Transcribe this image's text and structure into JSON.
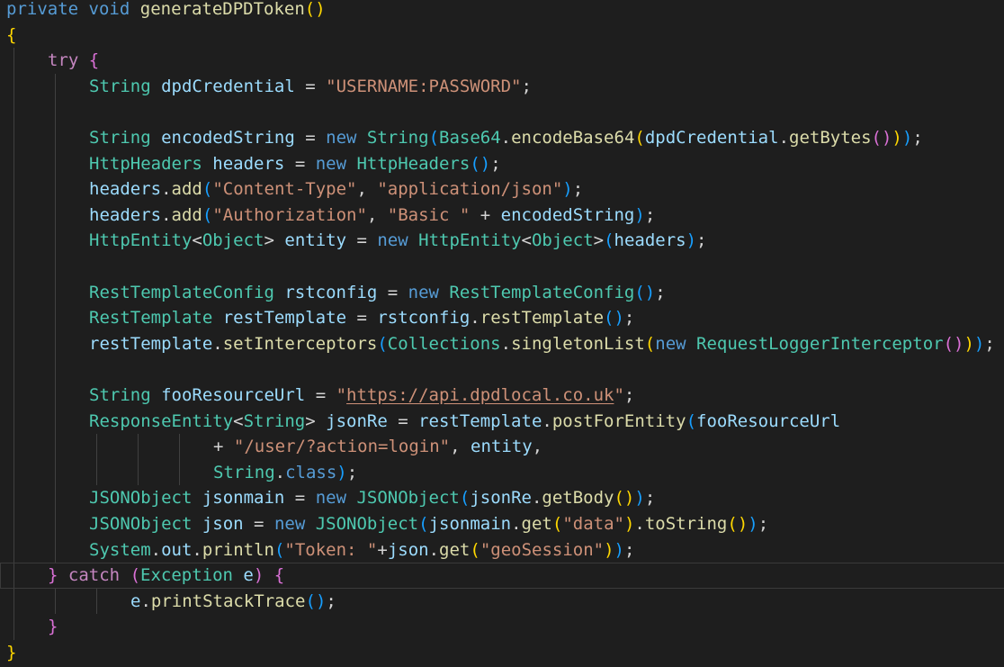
{
  "editor": {
    "language": "java",
    "colors": {
      "background": "#1e1e1e",
      "keyword": "#569cd6",
      "control": "#c586c0",
      "type": "#4ec9b0",
      "function": "#dcdcaa",
      "variable": "#9cdcfe",
      "string": "#ce9178",
      "punctuation": "#d4d4d4",
      "bracket_level_1": "#ffd700",
      "bracket_level_2": "#da70d6",
      "bracket_level_3": "#179fff"
    },
    "lines": [
      {
        "indent": 0,
        "tokens": [
          [
            "private",
            "kw"
          ],
          [
            " ",
            "punct"
          ],
          [
            "void",
            "kw"
          ],
          [
            " ",
            "punct"
          ],
          [
            "generateDPDToken",
            "fn"
          ],
          [
            "()",
            "b1"
          ]
        ]
      },
      {
        "indent": 0,
        "tokens": [
          [
            "{",
            "b1"
          ]
        ]
      },
      {
        "indent": 1,
        "tokens": [
          [
            "try",
            "ctl"
          ],
          [
            " ",
            "punct"
          ],
          [
            "{",
            "b2"
          ]
        ]
      },
      {
        "indent": 2,
        "tokens": [
          [
            "String",
            "type"
          ],
          [
            " ",
            "punct"
          ],
          [
            "dpdCredential",
            "var"
          ],
          [
            " = ",
            "punct"
          ],
          [
            "\"USERNAME:PASSWORD\"",
            "str"
          ],
          [
            ";",
            "punct"
          ]
        ]
      },
      {
        "indent": 2,
        "tokens": []
      },
      {
        "indent": 2,
        "tokens": [
          [
            "String",
            "type"
          ],
          [
            " ",
            "punct"
          ],
          [
            "encodedString",
            "var"
          ],
          [
            " = ",
            "punct"
          ],
          [
            "new",
            "kw"
          ],
          [
            " ",
            "punct"
          ],
          [
            "String",
            "type"
          ],
          [
            "(",
            "b3"
          ],
          [
            "Base64",
            "type"
          ],
          [
            ".",
            "punct"
          ],
          [
            "encodeBase64",
            "fn"
          ],
          [
            "(",
            "b1"
          ],
          [
            "dpdCredential",
            "var"
          ],
          [
            ".",
            "punct"
          ],
          [
            "getBytes",
            "fn"
          ],
          [
            "()",
            "b2"
          ],
          [
            ")",
            "b1"
          ],
          [
            ")",
            "b3"
          ],
          [
            ";",
            "punct"
          ]
        ]
      },
      {
        "indent": 2,
        "tokens": [
          [
            "HttpHeaders",
            "type"
          ],
          [
            " ",
            "punct"
          ],
          [
            "headers",
            "var"
          ],
          [
            " = ",
            "punct"
          ],
          [
            "new",
            "kw"
          ],
          [
            " ",
            "punct"
          ],
          [
            "HttpHeaders",
            "type"
          ],
          [
            "()",
            "b3"
          ],
          [
            ";",
            "punct"
          ]
        ]
      },
      {
        "indent": 2,
        "tokens": [
          [
            "headers",
            "var"
          ],
          [
            ".",
            "punct"
          ],
          [
            "add",
            "fn"
          ],
          [
            "(",
            "b3"
          ],
          [
            "\"Content-Type\"",
            "str"
          ],
          [
            ", ",
            "punct"
          ],
          [
            "\"application/json\"",
            "str"
          ],
          [
            ")",
            "b3"
          ],
          [
            ";",
            "punct"
          ]
        ]
      },
      {
        "indent": 2,
        "tokens": [
          [
            "headers",
            "var"
          ],
          [
            ".",
            "punct"
          ],
          [
            "add",
            "fn"
          ],
          [
            "(",
            "b3"
          ],
          [
            "\"Authorization\"",
            "str"
          ],
          [
            ", ",
            "punct"
          ],
          [
            "\"Basic \"",
            "str"
          ],
          [
            " + ",
            "punct"
          ],
          [
            "encodedString",
            "var"
          ],
          [
            ")",
            "b3"
          ],
          [
            ";",
            "punct"
          ]
        ]
      },
      {
        "indent": 2,
        "tokens": [
          [
            "HttpEntity",
            "type"
          ],
          [
            "<",
            "punct"
          ],
          [
            "Object",
            "type"
          ],
          [
            "> ",
            "punct"
          ],
          [
            "entity",
            "var"
          ],
          [
            " = ",
            "punct"
          ],
          [
            "new",
            "kw"
          ],
          [
            " ",
            "punct"
          ],
          [
            "HttpEntity",
            "type"
          ],
          [
            "<",
            "punct"
          ],
          [
            "Object",
            "type"
          ],
          [
            ">",
            "punct"
          ],
          [
            "(",
            "b3"
          ],
          [
            "headers",
            "var"
          ],
          [
            ")",
            "b3"
          ],
          [
            ";",
            "punct"
          ]
        ]
      },
      {
        "indent": 2,
        "tokens": []
      },
      {
        "indent": 2,
        "tokens": [
          [
            "RestTemplateConfig",
            "type"
          ],
          [
            " ",
            "punct"
          ],
          [
            "rstconfig",
            "var"
          ],
          [
            " = ",
            "punct"
          ],
          [
            "new",
            "kw"
          ],
          [
            " ",
            "punct"
          ],
          [
            "RestTemplateConfig",
            "type"
          ],
          [
            "()",
            "b3"
          ],
          [
            ";",
            "punct"
          ]
        ]
      },
      {
        "indent": 2,
        "tokens": [
          [
            "RestTemplate",
            "type"
          ],
          [
            " ",
            "punct"
          ],
          [
            "restTemplate",
            "var"
          ],
          [
            " = ",
            "punct"
          ],
          [
            "rstconfig",
            "var"
          ],
          [
            ".",
            "punct"
          ],
          [
            "restTemplate",
            "fn"
          ],
          [
            "()",
            "b3"
          ],
          [
            ";",
            "punct"
          ]
        ]
      },
      {
        "indent": 2,
        "tokens": [
          [
            "restTemplate",
            "var"
          ],
          [
            ".",
            "punct"
          ],
          [
            "setInterceptors",
            "fn"
          ],
          [
            "(",
            "b3"
          ],
          [
            "Collections",
            "type"
          ],
          [
            ".",
            "punct"
          ],
          [
            "singletonList",
            "fn"
          ],
          [
            "(",
            "b1"
          ],
          [
            "new",
            "kw"
          ],
          [
            " ",
            "punct"
          ],
          [
            "RequestLoggerInterceptor",
            "type"
          ],
          [
            "()",
            "b2"
          ],
          [
            ")",
            "b1"
          ],
          [
            ")",
            "b3"
          ],
          [
            ";",
            "punct"
          ]
        ]
      },
      {
        "indent": 2,
        "tokens": []
      },
      {
        "indent": 2,
        "tokens": [
          [
            "String",
            "type"
          ],
          [
            " ",
            "punct"
          ],
          [
            "fooResourceUrl",
            "var"
          ],
          [
            " = ",
            "punct"
          ],
          [
            "\"",
            "str"
          ],
          [
            "https://api.dpdlocal.co.uk",
            "url"
          ],
          [
            "\"",
            "str"
          ],
          [
            ";",
            "punct"
          ]
        ]
      },
      {
        "indent": 2,
        "tokens": [
          [
            "ResponseEntity",
            "type"
          ],
          [
            "<",
            "punct"
          ],
          [
            "String",
            "type"
          ],
          [
            "> ",
            "punct"
          ],
          [
            "jsonRe",
            "var"
          ],
          [
            " = ",
            "punct"
          ],
          [
            "restTemplate",
            "var"
          ],
          [
            ".",
            "punct"
          ],
          [
            "postForEntity",
            "fn"
          ],
          [
            "(",
            "b3"
          ],
          [
            "fooResourceUrl",
            "var"
          ]
        ]
      },
      {
        "indent": 5,
        "tokens": [
          [
            "+ ",
            "punct"
          ],
          [
            "\"/user/?action=login\"",
            "str"
          ],
          [
            ", ",
            "punct"
          ],
          [
            "entity",
            "var"
          ],
          [
            ",",
            "punct"
          ]
        ]
      },
      {
        "indent": 5,
        "tokens": [
          [
            "String",
            "type"
          ],
          [
            ".",
            "punct"
          ],
          [
            "class",
            "kw"
          ],
          [
            ")",
            "b3"
          ],
          [
            ";",
            "punct"
          ]
        ]
      },
      {
        "indent": 2,
        "tokens": [
          [
            "JSONObject",
            "type"
          ],
          [
            " ",
            "punct"
          ],
          [
            "jsonmain",
            "var"
          ],
          [
            " = ",
            "punct"
          ],
          [
            "new",
            "kw"
          ],
          [
            " ",
            "punct"
          ],
          [
            "JSONObject",
            "type"
          ],
          [
            "(",
            "b3"
          ],
          [
            "jsonRe",
            "var"
          ],
          [
            ".",
            "punct"
          ],
          [
            "getBody",
            "fn"
          ],
          [
            "()",
            "b1"
          ],
          [
            ")",
            "b3"
          ],
          [
            ";",
            "punct"
          ]
        ]
      },
      {
        "indent": 2,
        "tokens": [
          [
            "JSONObject",
            "type"
          ],
          [
            " ",
            "punct"
          ],
          [
            "json",
            "var"
          ],
          [
            " = ",
            "punct"
          ],
          [
            "new",
            "kw"
          ],
          [
            " ",
            "punct"
          ],
          [
            "JSONObject",
            "type"
          ],
          [
            "(",
            "b3"
          ],
          [
            "jsonmain",
            "var"
          ],
          [
            ".",
            "punct"
          ],
          [
            "get",
            "fn"
          ],
          [
            "(",
            "b1"
          ],
          [
            "\"data\"",
            "str"
          ],
          [
            ")",
            "b1"
          ],
          [
            ".",
            "punct"
          ],
          [
            "toString",
            "fn"
          ],
          [
            "()",
            "b1"
          ],
          [
            ")",
            "b3"
          ],
          [
            ";",
            "punct"
          ]
        ]
      },
      {
        "indent": 2,
        "tokens": [
          [
            "System",
            "type"
          ],
          [
            ".",
            "punct"
          ],
          [
            "out",
            "var"
          ],
          [
            ".",
            "punct"
          ],
          [
            "println",
            "fn"
          ],
          [
            "(",
            "b3"
          ],
          [
            "\"Token: \"",
            "str"
          ],
          [
            "+",
            "punct"
          ],
          [
            "json",
            "var"
          ],
          [
            ".",
            "punct"
          ],
          [
            "get",
            "fn"
          ],
          [
            "(",
            "b1"
          ],
          [
            "\"geoSession\"",
            "str"
          ],
          [
            ")",
            "b1"
          ],
          [
            ")",
            "b3"
          ],
          [
            ";",
            "punct"
          ]
        ]
      },
      {
        "indent": 1,
        "tokens": [
          [
            "}",
            "b2"
          ],
          [
            " ",
            "punct"
          ],
          [
            "catch",
            "ctl"
          ],
          [
            " ",
            "punct"
          ],
          [
            "(",
            "b2"
          ],
          [
            "Exception",
            "type"
          ],
          [
            " ",
            "punct"
          ],
          [
            "e",
            "var"
          ],
          [
            ")",
            "b2"
          ],
          [
            " ",
            "punct"
          ],
          [
            "{",
            "b2"
          ]
        ]
      },
      {
        "indent": 3,
        "tokens": [
          [
            "e",
            "var"
          ],
          [
            ".",
            "punct"
          ],
          [
            "printStackTrace",
            "fn"
          ],
          [
            "()",
            "b3"
          ],
          [
            ";",
            "punct"
          ]
        ]
      },
      {
        "indent": 1,
        "tokens": [
          [
            "}",
            "b2"
          ]
        ]
      },
      {
        "indent": 0,
        "tokens": [
          [
            "}",
            "b1"
          ]
        ]
      }
    ]
  }
}
